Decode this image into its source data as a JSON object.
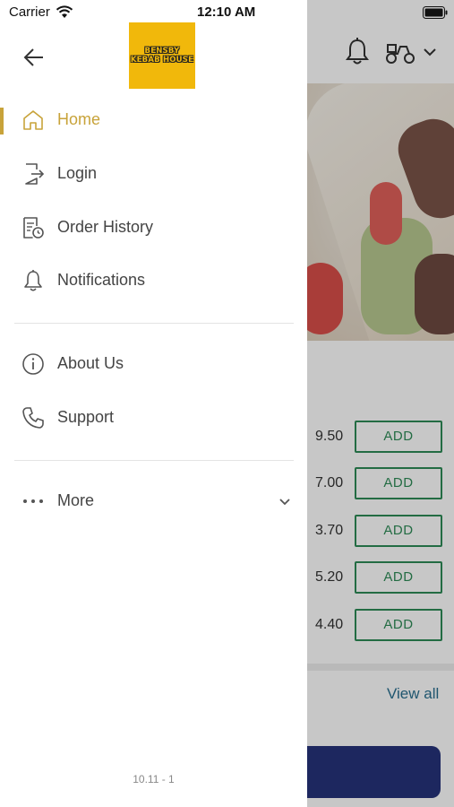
{
  "status_bar": {
    "carrier": "Carrier",
    "time": "12:10 AM"
  },
  "drawer": {
    "logo_text": [
      "BENSBY",
      "KEBAB HOUSE"
    ],
    "menu": [
      {
        "label": "Home",
        "icon": "home-icon",
        "active": true
      },
      {
        "label": "Login",
        "icon": "login-icon",
        "active": false
      },
      {
        "label": "Order History",
        "icon": "order-history-icon",
        "active": false
      },
      {
        "label": "Notifications",
        "icon": "bell-icon",
        "active": false
      }
    ],
    "secondary_menu": [
      {
        "label": "About Us",
        "icon": "info-icon"
      },
      {
        "label": "Support",
        "icon": "phone-icon"
      }
    ],
    "more_label": "More",
    "version": "10.11 - 1",
    "accent_color": "#c8a33a"
  },
  "background": {
    "items": [
      {
        "price": "9.50",
        "button": "ADD"
      },
      {
        "price": "7.00",
        "button": "ADD"
      },
      {
        "price": "3.70",
        "button": "ADD"
      },
      {
        "price": "5.20",
        "button": "ADD"
      },
      {
        "price": "4.40",
        "button": "ADD"
      }
    ],
    "view_all": "View all"
  }
}
